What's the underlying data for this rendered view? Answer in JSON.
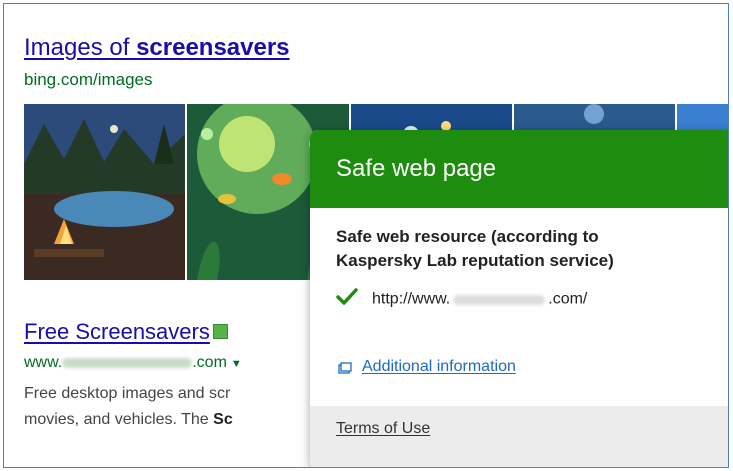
{
  "images_result": {
    "title_prefix": "Images of ",
    "title_bold": "screensavers",
    "url": "bing.com/images"
  },
  "web_result": {
    "title": "Free Screensavers",
    "url_prefix": "www.",
    "url_suffix": ".com",
    "snippet_line1": "Free desktop images and scr",
    "snippet_line2_prefix": "movies, and vehicles. The ",
    "snippet_line2_bold": "Sc"
  },
  "popup": {
    "header": "Safe web page",
    "heading_line1": "Safe web resource (according to",
    "heading_line2": "Kaspersky Lab reputation service)",
    "url_prefix": "http://www.",
    "url_suffix": ".com/",
    "more_info": "Additional information",
    "terms": "Terms of Use",
    "header_color": "#1e8c0e",
    "check_color": "#1e8c0e"
  },
  "icons": [
    "safe-badge-icon",
    "checkmark-icon",
    "external-window-icon",
    "dropdown-caret-icon"
  ]
}
